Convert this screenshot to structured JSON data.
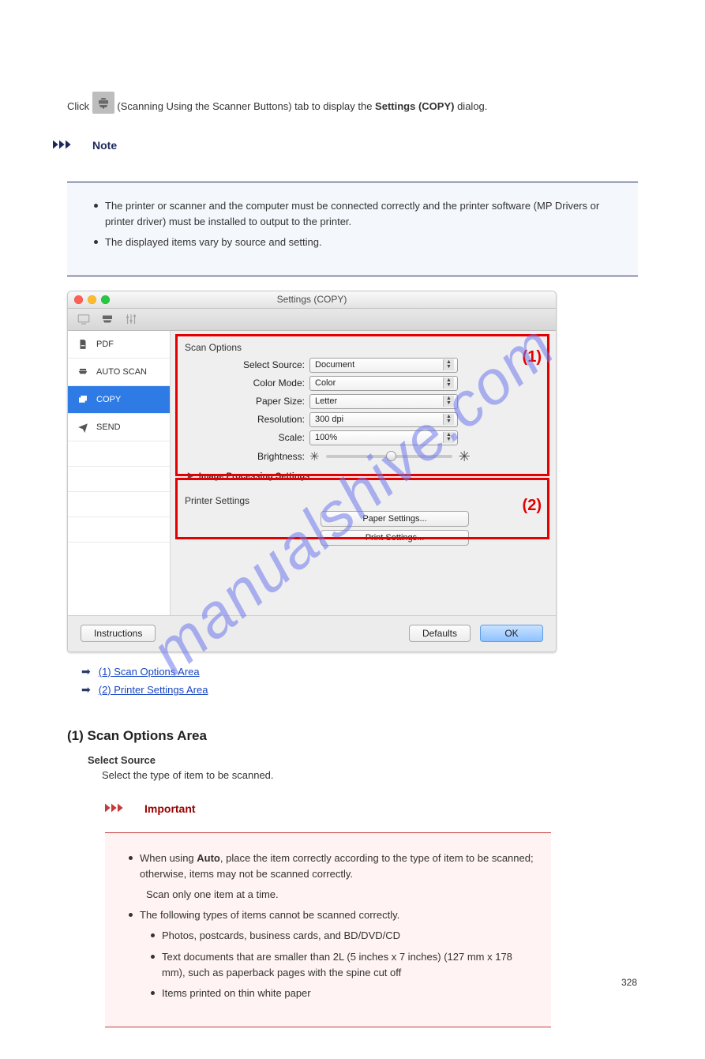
{
  "intro": {
    "prefix": "Click ",
    "tab_label": " (Scanning Using the Scanner Buttons) tab to display the ",
    "strong1": "Settings (COPY)",
    "suffix": " dialog."
  },
  "note": {
    "label": "Note",
    "items": [
      "The printer or scanner and the computer must be connected correctly and the printer software (MP Drivers or printer driver) must be installed to output to the printer.",
      "The displayed items vary by source and setting."
    ]
  },
  "dialog": {
    "title": "Settings (COPY)",
    "sidebar": [
      {
        "icon": "pdf",
        "label": "PDF"
      },
      {
        "icon": "autoscan",
        "label": "AUTO SCAN"
      },
      {
        "icon": "copy",
        "label": "COPY"
      },
      {
        "icon": "send",
        "label": "SEND"
      }
    ],
    "scan_options_title": "Scan Options",
    "fields": {
      "select_source": {
        "label": "Select Source:",
        "value": "Document"
      },
      "color_mode": {
        "label": "Color Mode:",
        "value": "Color"
      },
      "paper_size": {
        "label": "Paper Size:",
        "value": "Letter"
      },
      "resolution": {
        "label": "Resolution:",
        "value": "300 dpi"
      },
      "scale": {
        "label": "Scale:",
        "value": "100%"
      },
      "brightness": {
        "label": "Brightness:"
      },
      "image_processing": "Image Processing Settings"
    },
    "printer_settings_title": "Printer Settings",
    "printer_buttons": {
      "paper": "Paper Settings...",
      "print": "Print Settings..."
    },
    "annotations": {
      "a1": "(1)",
      "a2": "(2)"
    },
    "footer": {
      "instructions": "Instructions",
      "defaults": "Defaults",
      "ok": "OK"
    }
  },
  "links": {
    "l1": "(1) Scan Options Area",
    "l2": "(2) Printer Settings Area"
  },
  "so_heading": "(1) Scan Options Area",
  "so_dt": "Select Source",
  "so_dd": "Select the type of item to be scanned.",
  "important": {
    "label": "Important",
    "lead_bold": "Auto",
    "lead_text": ", place the item correctly according to the type of item to be scanned; otherwise, items may not be scanned correctly.",
    "when": "When using ",
    "items": [
      "Photos, postcards, business cards, and BD/DVD/CD",
      "Text documents that are smaller than 2L (5 inches x 7 inches) (127 mm x 178 mm), such as paperback pages with the spine cut off",
      "Items printed on thin white paper"
    ],
    "cannot": "The following types of items cannot be scanned correctly.",
    "scan_one": "Scan only one item at a time."
  },
  "watermark": "manualshive.com",
  "page_number": "328"
}
